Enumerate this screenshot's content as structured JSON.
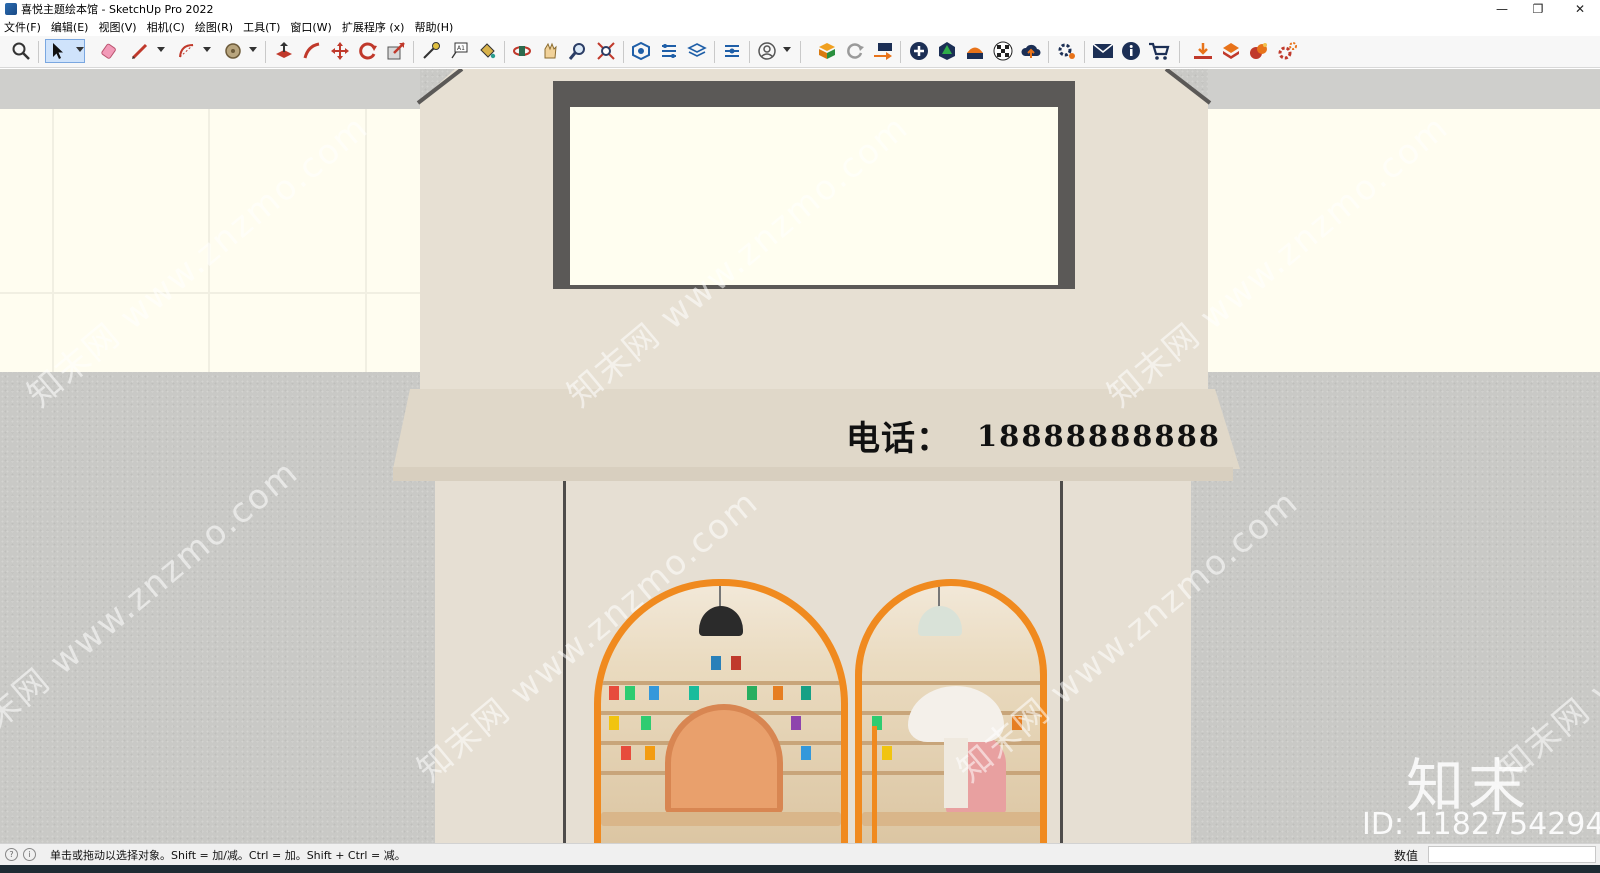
{
  "window": {
    "title": "喜悦主题绘本馆 - SketchUp Pro 2022",
    "controls": {
      "minimize": "—",
      "maximize": "❐",
      "close": "✕"
    }
  },
  "menu": [
    {
      "label": "文件(F)"
    },
    {
      "label": "编辑(E)"
    },
    {
      "label": "视图(V)"
    },
    {
      "label": "相机(C)"
    },
    {
      "label": "绘图(R)"
    },
    {
      "label": "工具(T)"
    },
    {
      "label": "窗口(W)"
    },
    {
      "label": "扩展程序 (x)"
    },
    {
      "label": "帮助(H)"
    }
  ],
  "toolbar": {
    "tools": [
      {
        "name": "zoom-extents-icon"
      },
      {
        "name": "select-icon",
        "active": true
      },
      {
        "name": "eraser-icon"
      },
      {
        "name": "pencil-icon"
      },
      {
        "name": "arc-icon"
      },
      {
        "name": "tape-icon"
      },
      {
        "name": "push-pull-icon"
      },
      {
        "name": "follow-me-icon"
      },
      {
        "name": "move-icon"
      },
      {
        "name": "rotate-icon"
      },
      {
        "name": "scale-icon"
      },
      {
        "name": "tape-measure-icon"
      },
      {
        "name": "text-icon"
      },
      {
        "name": "paint-bucket-icon"
      },
      {
        "name": "orbit-icon"
      },
      {
        "name": "pan-icon"
      },
      {
        "name": "zoom-icon"
      },
      {
        "name": "zoom-window-icon"
      },
      {
        "name": "warehouse-icon"
      },
      {
        "name": "extension-icon"
      },
      {
        "name": "layers-icon"
      },
      {
        "name": "styles-icon"
      },
      {
        "name": "profile-icon"
      },
      {
        "name": "plugin-icon"
      },
      {
        "name": "refresh-icon"
      },
      {
        "name": "export-icon"
      },
      {
        "name": "add-icon"
      },
      {
        "name": "tree-icon"
      },
      {
        "name": "render-icon"
      },
      {
        "name": "checker-icon"
      },
      {
        "name": "cloud-icon"
      },
      {
        "name": "settings-icon"
      },
      {
        "name": "mail-icon"
      },
      {
        "name": "info-icon"
      },
      {
        "name": "cart-icon"
      },
      {
        "name": "download-icon"
      },
      {
        "name": "upload-icon"
      },
      {
        "name": "material-icon"
      },
      {
        "name": "gear-icon"
      }
    ]
  },
  "scene": {
    "phone_label": "电话：",
    "phone_number": "18888888888",
    "watermark_text": "知末网 www.znzmo.com",
    "brand_logo": "知末",
    "brand_id": "ID: 1182754294",
    "colors": {
      "wall": "#e7e0d3",
      "frame": "#5b5957",
      "arch": "#f08a1f",
      "glass": "#fffef0"
    }
  },
  "statusbar": {
    "hint": "单击或拖动以选择对象。Shift = 加/减。Ctrl = 加。Shift + Ctrl = 减。",
    "measurements_label": "数值",
    "measurements_value": ""
  }
}
